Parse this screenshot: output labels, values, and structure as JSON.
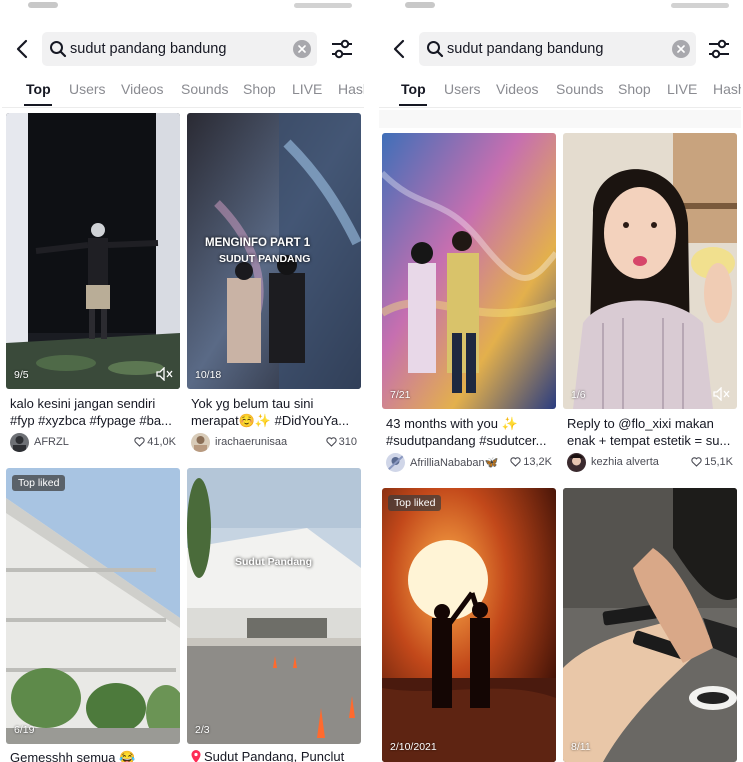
{
  "search": {
    "query": "sudut pandang bandung"
  },
  "tabs": [
    "Top",
    "Users",
    "Videos",
    "Sounds",
    "Shop",
    "LIVE",
    "Hash"
  ],
  "left": {
    "cards": [
      {
        "count": "9/5",
        "caption": "kalo kesini jangan sendiri #fyp #xyzbca #fypage #ba...",
        "user": "AFRZL",
        "likes": "41,0K"
      },
      {
        "count": "10/18",
        "overlay1": "MENGINFO PART 1",
        "overlay2": "SUDUT PANDANG",
        "caption": "Yok yg belum tau sini merapat☺️✨ #DidYouYa...",
        "user": "irachaerunisaa",
        "likes": "310"
      },
      {
        "badge": "Top liked",
        "count": "6/19",
        "caption": "Gemesshh semua 😂"
      },
      {
        "count": "2/3",
        "overlay1": "Sudut Pandang",
        "caption": "Sudut Pandang, Punclut"
      }
    ]
  },
  "right": {
    "cards": [
      {
        "count": "7/21",
        "caption": "43 months with you ✨ #sudutpandang #sudutcer...",
        "user": "AfrilliaNababan🦋",
        "likes": "13,2K"
      },
      {
        "count": "1/6",
        "caption": "Reply to @flo_xixi makan enak + tempat estetik = su...",
        "user": "kezhia alverta",
        "likes": "15,1K"
      },
      {
        "badge": "Top liked",
        "count": "2/10/2021"
      },
      {
        "count": "8/11"
      }
    ]
  },
  "colors": {
    "text": "#161823",
    "secondary": "#8a8b91",
    "searchbg": "#f1f1f2"
  }
}
